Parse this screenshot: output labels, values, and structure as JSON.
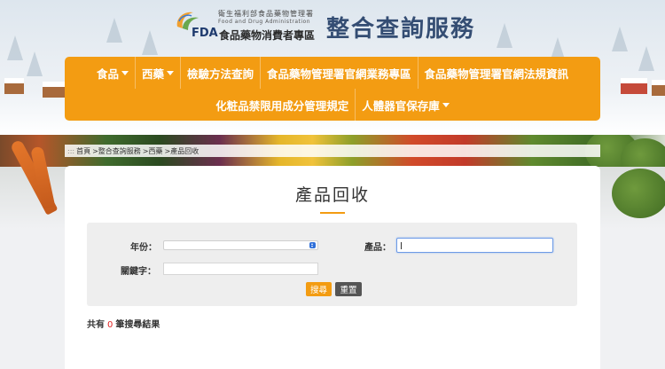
{
  "logo": {
    "agency_small": "衛生福利部食品藥物管理署",
    "agency_en": "Food and Drug Administration",
    "fda_mark": "FDA",
    "zone_name": "食品藥物消費者專區"
  },
  "site_title": "整合查詢服務",
  "nav": {
    "row1": [
      {
        "label": "食品",
        "dropdown": true
      },
      {
        "label": "西藥",
        "dropdown": true
      },
      {
        "label": "檢驗方法查詢",
        "dropdown": false
      },
      {
        "label": "食品藥物管理署官網業務專區",
        "dropdown": false
      },
      {
        "label": "食品藥物管理署官網法規資訊",
        "dropdown": false
      }
    ],
    "row2": [
      {
        "label": "化粧品禁限用成分管理規定",
        "dropdown": false
      },
      {
        "label": "人體器官保存庫",
        "dropdown": true
      }
    ]
  },
  "breadcrumb": {
    "prefix": ":::",
    "items": [
      "首頁",
      ">整合查詢服務",
      ">西藥",
      ">產品回收"
    ]
  },
  "page_title": "產品回收",
  "form": {
    "year_label": "年份：",
    "year_value": "",
    "product_label": "產品：",
    "product_value": "",
    "keyword_label": "關鍵字：",
    "keyword_value": "",
    "search_button": "搜尋",
    "reset_button": "重置"
  },
  "results": {
    "prefix": "共有",
    "count": "0",
    "suffix": "筆搜尋結果"
  },
  "colors": {
    "accent_orange": "#f39c12",
    "title_blue": "#344d73",
    "count_red": "#e02020",
    "reset_gray": "#555555"
  }
}
